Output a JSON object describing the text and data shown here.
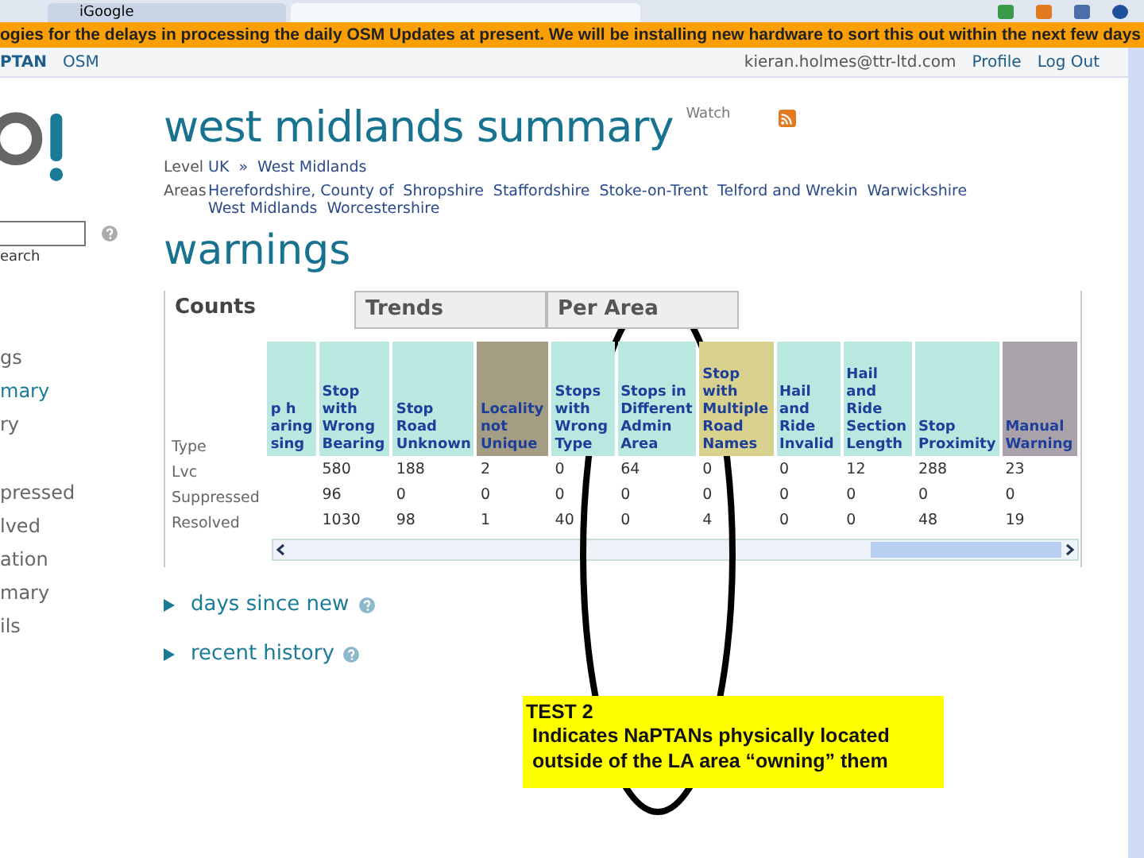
{
  "browser_tabs": [
    {
      "label": "iGoogle",
      "selected": false
    },
    {
      "selected": true
    }
  ],
  "banner": "ogies for the delays in processing the daily OSM Updates at present. We will be installing new hardware to sort this out within the next few days",
  "nav": {
    "left": [
      "PTAN",
      "OSM"
    ],
    "user": "kieran.holmes@ttr-ltd.com",
    "links": [
      "Profile",
      "Log Out"
    ]
  },
  "sidebar": {
    "search_label": "earch",
    "items": [
      {
        "label": "gs",
        "selected": false
      },
      {
        "label": "mary",
        "selected": true
      },
      {
        "label": "ry",
        "selected": false
      },
      {
        "label": "pressed",
        "selected": false
      },
      {
        "label": "lved",
        "selected": false
      },
      {
        "label": "ation",
        "selected": false
      },
      {
        "label": "mary",
        "selected": false
      },
      {
        "label": "ils",
        "selected": false
      }
    ]
  },
  "page": {
    "title": "west midlands summary",
    "watch": "Watch",
    "level_label": "Level",
    "level": [
      "UK",
      "West Midlands"
    ],
    "level_sep": "»",
    "areas_label": "Areas",
    "areas": [
      "Herefordshire, County of",
      "Shropshire",
      "Staffordshire",
      "Stoke-on-Trent",
      "Telford and Wrekin",
      "Warwickshire",
      "West Midlands",
      "Worcestershire"
    ]
  },
  "warnings": {
    "title": "warnings",
    "tabs": [
      {
        "label": "Counts",
        "selected": true
      },
      {
        "label": "Trends",
        "selected": false
      },
      {
        "label": "Per Area",
        "selected": false
      }
    ],
    "type_label": "Type",
    "columns": [
      {
        "header": "p h aring sing",
        "color": "#b9e8e0"
      },
      {
        "header": "Stop with Wrong Bearing",
        "color": "#b9e8e0"
      },
      {
        "header": "Stop Road Unknown",
        "color": "#b9e8e0"
      },
      {
        "header": "Locality not Unique",
        "color": "#a39d84"
      },
      {
        "header": "Stops with Wrong Type",
        "color": "#b9e8e0"
      },
      {
        "header": "Stops in Different Admin Area",
        "color": "#b9e8e0"
      },
      {
        "header": "Stop with Multiple Road Names",
        "color": "#d9d28f"
      },
      {
        "header": "Hail and Ride Invalid",
        "color": "#b9e8e0"
      },
      {
        "header": "Hail and Ride Section Length",
        "color": "#b9e8e0"
      },
      {
        "header": "Stop Proximity",
        "color": "#b9e8e0"
      },
      {
        "header": "Manual Warning",
        "color": "#a9a2aa"
      }
    ],
    "rows": [
      {
        "type": "Lvc",
        "cells": [
          "",
          "580",
          "188",
          "2",
          "0",
          "64",
          "0",
          "0",
          "12",
          "288",
          "23"
        ]
      },
      {
        "type": "Suppressed",
        "cells": [
          "",
          "96",
          "0",
          "0",
          "0",
          "0",
          "0",
          "0",
          "0",
          "0",
          "0"
        ]
      },
      {
        "type": "Resolved",
        "cells": [
          "",
          "1030",
          "98",
          "1",
          "40",
          "0",
          "4",
          "0",
          "0",
          "48",
          "19"
        ]
      }
    ]
  },
  "sections": [
    {
      "label": "days since new"
    },
    {
      "label": "recent history"
    }
  ],
  "note": {
    "title": "TEST 2",
    "text": "Indicates NaPTANs physically located outside of the LA area “owning” them"
  }
}
